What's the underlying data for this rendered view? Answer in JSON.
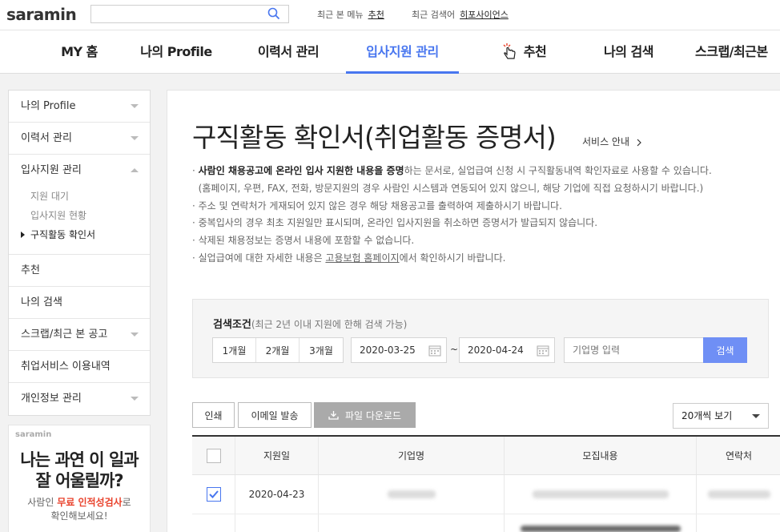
{
  "header": {
    "logo": "saramin",
    "search_placeholder": "",
    "recent_menu_label": "최근 본 메뉴",
    "recent_menu_link": "추천",
    "recent_search_label": "최근 검색어",
    "recent_search_link": "히포사이언스"
  },
  "gnb": {
    "items": [
      "MY 홈",
      "나의 Profile",
      "이력서 관리",
      "입사지원 관리",
      "추천",
      "나의 검색",
      "스크랩/최근본"
    ],
    "active": "입사지원 관리"
  },
  "sidebar": {
    "items": [
      "나의 Profile",
      "이력서 관리",
      "입사지원 관리",
      "추천",
      "나의 검색",
      "스크랩/최근 본 공고",
      "취업서비스 이용내역",
      "개인정보 관리"
    ],
    "sub_items": [
      "지원 대기",
      "입사지원 현황",
      "구직활동 확인서"
    ],
    "current_sub": "구직활동 확인서"
  },
  "ad": {
    "logo": "saramin",
    "title_line1": "나는 과연 이 일과",
    "title_line2": "잘 어울릴까?",
    "sub_pre": "사람인 ",
    "sub_em": "무료 인적성검사",
    "sub_post": "로",
    "sub_line2": "확인해보세요!"
  },
  "main": {
    "title": "구직활동 확인서(취업활동 증명서)",
    "service_link": "서비스 안내",
    "notices": {
      "n1_strong": "사람인 채용공고에 온라인 입사 지원한 내용을 증명",
      "n1_rest": "하는 문서로, 실업급여 신청 시 구직활동내역 확인자료로 사용할 수 있습니다.",
      "n1_line2": "(홈페이지, 우편, FAX, 전화, 방문지원의 경우 사람인 시스템과 연동되어 있지 않으니, 해당 기업에 직접 요청하시기 바랍니다.)",
      "n2": "주소 및 연락처가 게재되어 있지 않은 경우 해당 채용공고를 출력하여 제출하시기 바랍니다.",
      "n3": "중복입사의 경우 최초 지원일만 표시되며, 온라인 입사지원을 취소하면 증명서가 발급되지 않습니다.",
      "n4": "삭제된 채용정보는 증명서 내용에 포함할 수 없습니다.",
      "n5_pre": "실업급여에 대한 자세한 내용은 ",
      "n5_link": "고용보험 홈페이지",
      "n5_post": "에서 확인하시기 바랍니다."
    }
  },
  "search": {
    "label": "검색조건",
    "label_note": "(최근 2년 이내 지원에 한해 검색 가능)",
    "periods": [
      "1개월",
      "2개월",
      "3개월"
    ],
    "date_from": "2020-03-25",
    "date_sep": "~",
    "date_to": "2020-04-24",
    "company_placeholder": "기업명 입력",
    "submit": "검색"
  },
  "actions": {
    "print": "인쇄",
    "email": "이메일 발송",
    "download": "파일 다운로드",
    "per_page": "20개씩 보기"
  },
  "table": {
    "headers": [
      "지원일",
      "기업명",
      "모집내용",
      "연락처"
    ],
    "rows": [
      {
        "date": "2020-04-23",
        "checked": true
      }
    ]
  },
  "colors": {
    "accent": "#4876ef",
    "search_button": "#6f8ff5",
    "ad_highlight": "#e9422c"
  }
}
